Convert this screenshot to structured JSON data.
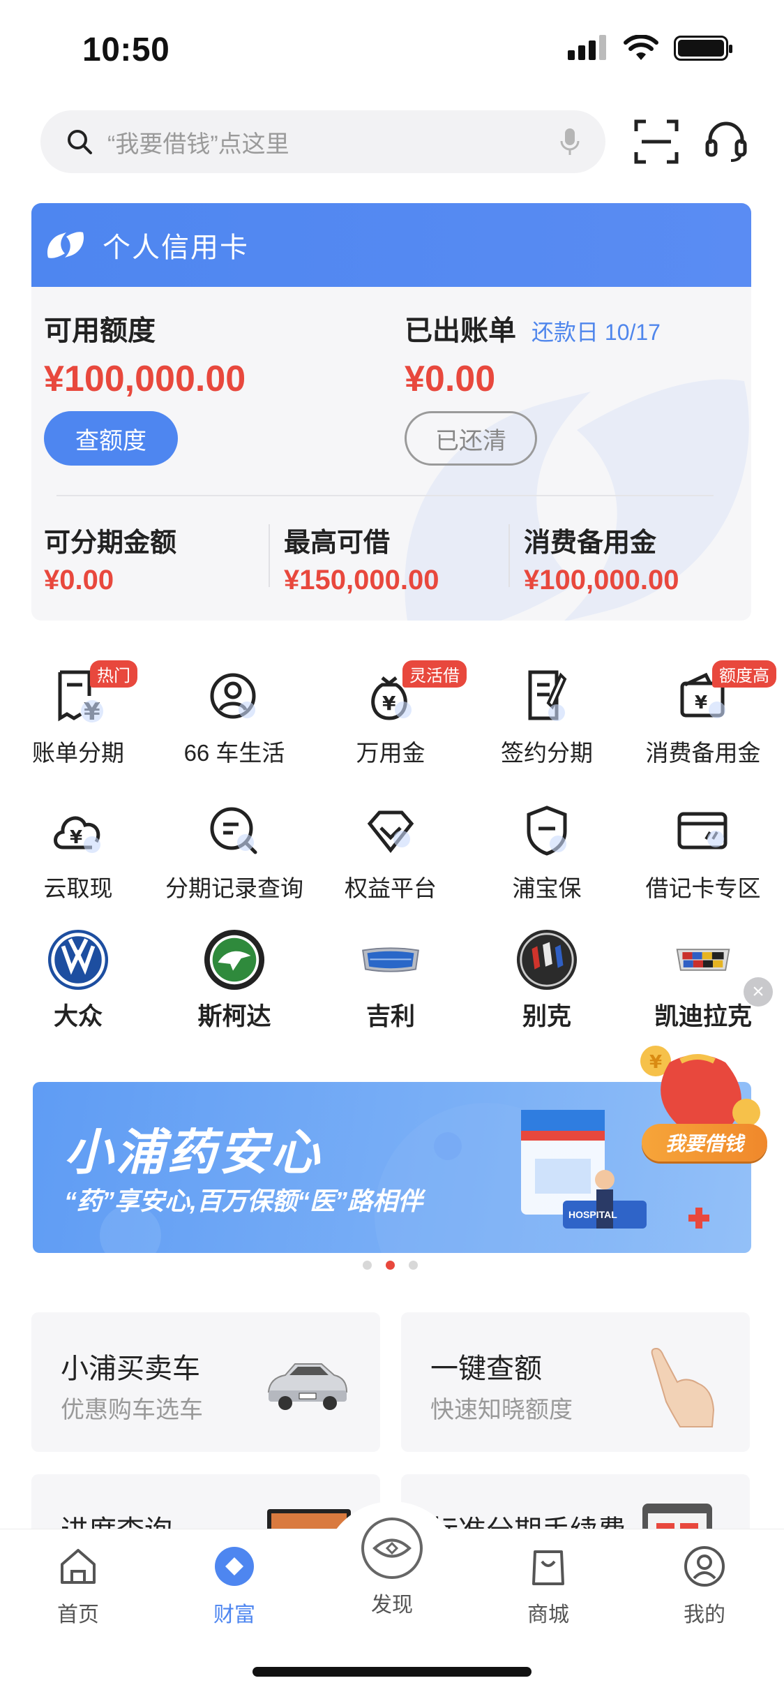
{
  "status": {
    "time": "10:50"
  },
  "search": {
    "placeholder": "“我要借钱”点这里"
  },
  "card": {
    "title": "个人信用卡",
    "available_label": "可用额度",
    "available_amount": "¥100,000.00",
    "billed_label": "已出账单",
    "due_date": "还款日 10/17",
    "billed_amount": "¥0.00",
    "check_quota_label": "查额度",
    "paid_label": "已还清",
    "stats": [
      {
        "label": "可分期金额",
        "value": "¥0.00"
      },
      {
        "label": "最高可借",
        "value": "¥150,000.00"
      },
      {
        "label": "消费备用金",
        "value": "¥100,000.00"
      }
    ]
  },
  "grid_row1": [
    {
      "label": "账单分期",
      "tag": "热门",
      "icon": "bill-installment-icon"
    },
    {
      "label": "66 车生活",
      "tag": "",
      "icon": "car-life-icon"
    },
    {
      "label": "万用金",
      "tag": "灵活借",
      "icon": "money-bag-icon"
    },
    {
      "label": "签约分期",
      "tag": "",
      "icon": "contract-icon"
    },
    {
      "label": "消费备用金",
      "tag": "额度高",
      "icon": "wallet-icon"
    }
  ],
  "grid_row2": [
    {
      "label": "云取现",
      "icon": "cloud-cash-icon"
    },
    {
      "label": "分期记录查询",
      "icon": "record-search-icon"
    },
    {
      "label": "权益平台",
      "icon": "diamond-icon"
    },
    {
      "label": "浦宝保",
      "icon": "shield-icon"
    },
    {
      "label": "借记卡专区",
      "icon": "debit-card-icon"
    }
  ],
  "brands": [
    {
      "label": "大众",
      "icon": "volkswagen-logo-icon"
    },
    {
      "label": "斯柯达",
      "icon": "skoda-logo-icon"
    },
    {
      "label": "吉利",
      "icon": "geely-logo-icon"
    },
    {
      "label": "别克",
      "icon": "buick-logo-icon"
    },
    {
      "label": "凯迪拉克",
      "icon": "cadillac-logo-icon"
    }
  ],
  "banner": {
    "title": "小浦药安心",
    "subtitle": "“药”享安心,百万保额“医”路相伴",
    "sign_text": "HOSPITAL"
  },
  "loan_float": {
    "label": "我要借钱"
  },
  "tiles": [
    {
      "title": "小浦买卖车",
      "subtitle": "优惠购车选车"
    },
    {
      "title": "一键查额",
      "subtitle": "快速知晓额度"
    },
    {
      "title": "进度查询",
      "subtitle": ""
    },
    {
      "title": "标准分期手续费",
      "subtitle": ""
    }
  ],
  "tabbar": [
    {
      "label": "首页",
      "icon": "home-icon"
    },
    {
      "label": "财富",
      "icon": "wealth-icon"
    },
    {
      "label": "发现",
      "icon": "discover-eye-icon"
    },
    {
      "label": "商城",
      "icon": "shopping-bag-icon"
    },
    {
      "label": "我的",
      "icon": "profile-icon"
    }
  ],
  "colors": {
    "accent": "#4e86f0",
    "alert": "#e8483d"
  }
}
